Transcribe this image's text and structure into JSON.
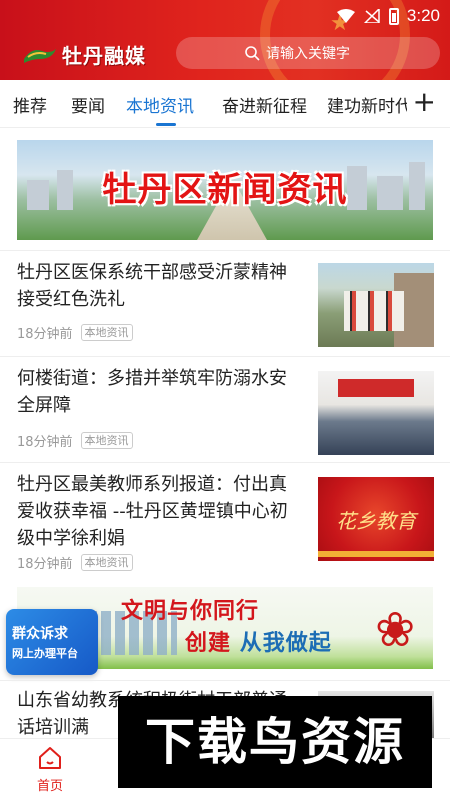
{
  "status": {
    "time": "3:20"
  },
  "header": {
    "app_name": "牡丹融媒",
    "search_placeholder": "请输入关键字"
  },
  "tabs": [
    {
      "label": "推荐"
    },
    {
      "label": "要闻"
    },
    {
      "label": "本地资讯",
      "active": true
    },
    {
      "label": "奋进新征程"
    },
    {
      "label": "建功新时代"
    }
  ],
  "add_tab_label": "+",
  "banner_top": {
    "title": "牡丹区新闻资讯"
  },
  "news": [
    {
      "title": "牡丹区医保系统干部感受沂蒙精神  接受红色洗礼",
      "time": "18分钟前",
      "tag": "本地资讯"
    },
    {
      "title": "何楼街道：多措并举筑牢防溺水安全屏障",
      "time": "18分钟前",
      "tag": "本地资讯"
    },
    {
      "title": "牡丹区最美教师系列报道：付出真爱收获幸福 --牡丹区黄堽镇中心初级中学徐利娟",
      "time": "18分钟前",
      "tag": "本地资讯",
      "thumb_text": "花乡教育"
    },
    {
      "title": "山东省幼教系统积极街村干部普通话培训满",
      "time": "",
      "tag": ""
    }
  ],
  "banner_mid": {
    "line1": "文明与你同行",
    "line2_a": "创建",
    "line2_b": "从我做起"
  },
  "float_badge": {
    "line1": "群众诉求",
    "line2": "网上办理平台"
  },
  "bottom_nav": {
    "home_label": "首页"
  },
  "watermark": "下载鸟资源",
  "colors": {
    "brand_red": "#e0241d",
    "active_blue": "#1a75d2"
  }
}
